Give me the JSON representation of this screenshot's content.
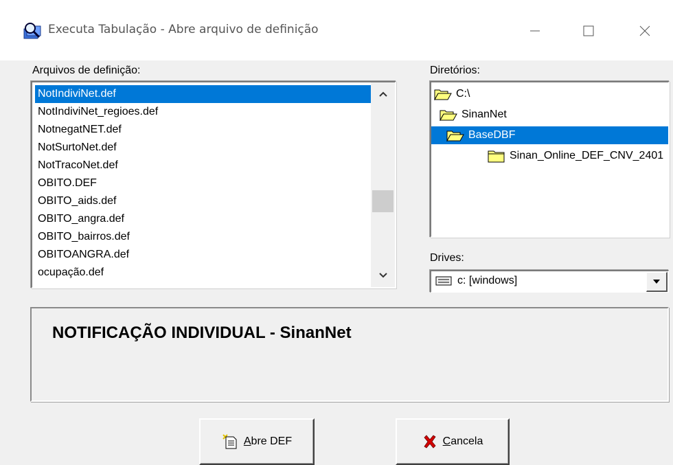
{
  "window": {
    "title": "Executa Tabulação - Abre arquivo de definição",
    "controls": {
      "minimize": "—",
      "maximize": "☐",
      "close": "✕"
    }
  },
  "files": {
    "label": "Arquivos de definição:",
    "items": [
      "NotIndiviNet.def",
      "NotIndiviNet_regioes.def",
      "NotnegatNET.def",
      "NotSurtoNet.def",
      "NotTracoNet.def",
      "OBITO.DEF",
      "OBITO_aids.def",
      "OBITO_angra.def",
      "OBITO_bairros.def",
      "OBITOANGRA.def",
      "ocupação.def"
    ],
    "selected_index": 0,
    "scroll_position": 0.62
  },
  "directories": {
    "label": "Diretórios:",
    "items": [
      "C:\\",
      "SinanNet",
      "BaseDBF",
      "Sinan_Online_DEF_CNV_2401"
    ],
    "selected_index": 2
  },
  "drives": {
    "label": "Drives:",
    "value": "c: [windows]"
  },
  "description": {
    "text": "NOTIFICAÇÃO INDIVIDUAL - SinanNet"
  },
  "buttons": {
    "open": {
      "mnemonic": "A",
      "rest": "bre DEF"
    },
    "cancel": {
      "mnemonic": "C",
      "rest": "ancela"
    }
  },
  "colors": {
    "selection": "#0078d7",
    "folder": "#ffff80",
    "cancel_icon": "#d40000"
  }
}
